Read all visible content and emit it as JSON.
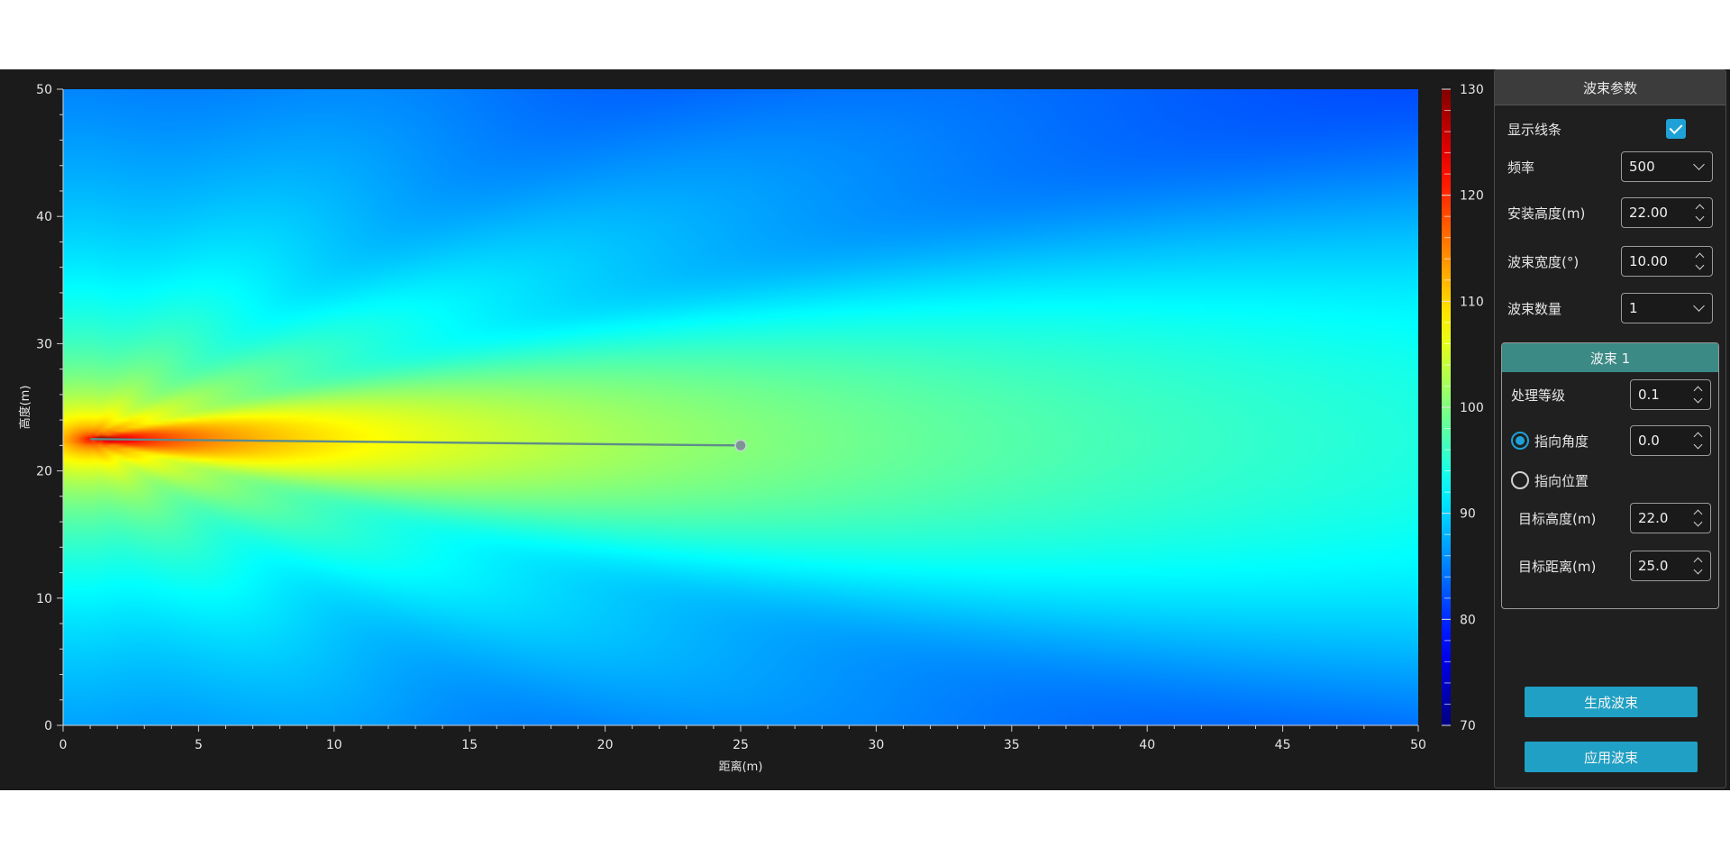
{
  "chart_data": {
    "type": "heatmap",
    "xlabel": "距离(m)",
    "ylabel": "高度(m)",
    "xlim": [
      0,
      50
    ],
    "ylim": [
      0,
      50
    ],
    "x_ticks": [
      0,
      5,
      10,
      15,
      20,
      25,
      30,
      35,
      40,
      45,
      50
    ],
    "y_ticks": [
      0,
      10,
      20,
      30,
      40,
      50
    ],
    "colorbar": {
      "min": 70,
      "max": 130,
      "ticks": [
        70,
        80,
        90,
        100,
        110,
        120,
        130
      ]
    },
    "colormap": "jet",
    "source": {
      "x": 1,
      "y": 22.5
    },
    "beam_line": {
      "x": [
        1,
        25
      ],
      "y": [
        22.5,
        22.0
      ]
    }
  },
  "panel": {
    "title": "波束参数",
    "show_lines_label": "显示线条",
    "show_lines_checked": true,
    "frequency_label": "频率",
    "frequency_value": "500",
    "install_height_label": "安装高度(m)",
    "install_height_value": "22.00",
    "beam_width_label": "波束宽度(°)",
    "beam_width_value": "10.00",
    "beam_count_label": "波束数量",
    "beam_count_value": "1",
    "beam": {
      "title": "波束 1",
      "process_level_label": "处理等级",
      "process_level_value": "0.1",
      "pointing_angle_label": "指向角度",
      "pointing_angle_value": "0.0",
      "pointing_angle_selected": true,
      "pointing_position_label": "指向位置",
      "target_height_label": "目标高度(m)",
      "target_height_value": "22.0",
      "target_distance_label": "目标距离(m)",
      "target_distance_value": "25.0"
    },
    "generate_button": "生成波束",
    "apply_button": "应用波束"
  },
  "colors": {
    "background": "#1b1b1b",
    "accent": "#1fa0c4",
    "group_header": "#3b8a86"
  }
}
